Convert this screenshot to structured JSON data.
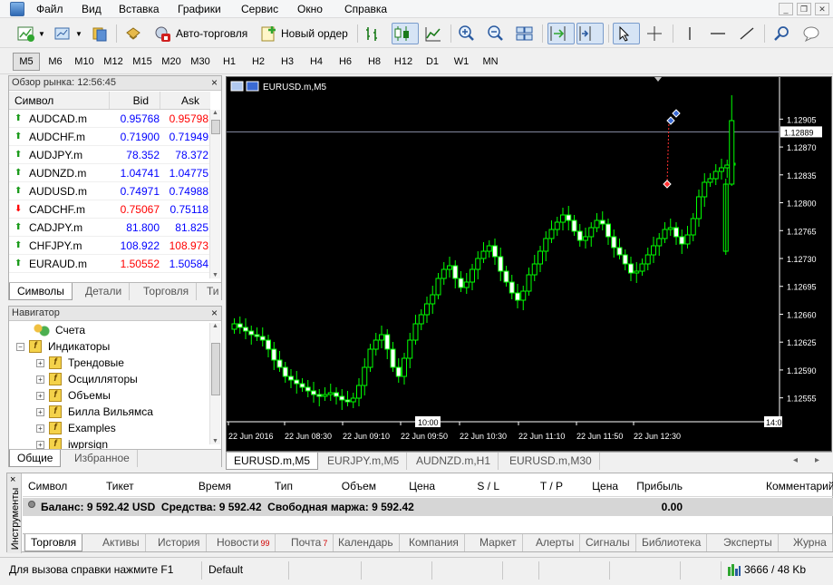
{
  "menu": [
    "Файл",
    "Вид",
    "Вставка",
    "Графики",
    "Сервис",
    "Окно",
    "Справка"
  ],
  "toolbar": {
    "autotrading_label": "Авто-торговля",
    "new_order_label": "Новый ордер"
  },
  "timeframes": [
    "M5",
    "M10",
    "M6",
    "M12",
    "M15",
    "M20",
    "M30",
    "H1",
    "H2",
    "H3",
    "H4",
    "H6",
    "H8",
    "H12",
    "D1",
    "W1",
    "MN"
  ],
  "timeframes_display": [
    "M5",
    "M6",
    "M10",
    "M12",
    "M15",
    "M20",
    "M30",
    "H1",
    "H2",
    "H3",
    "H4",
    "H6",
    "H8",
    "H12",
    "D1",
    "W1",
    "MN"
  ],
  "active_timeframe": "M5",
  "market_watch": {
    "title": "Обзор рынка: 12:56:45",
    "col_symbol": "Символ",
    "col_bid": "Bid",
    "col_ask": "Ask",
    "rows": [
      {
        "symbol": "AUDCAD.m",
        "bid": "0.95768",
        "ask": "0.95798",
        "dir": "up",
        "bid_color": "blue",
        "ask_color": "red"
      },
      {
        "symbol": "AUDCHF.m",
        "bid": "0.71900",
        "ask": "0.71949",
        "dir": "up",
        "bid_color": "blue",
        "ask_color": "blue"
      },
      {
        "symbol": "AUDJPY.m",
        "bid": "78.352",
        "ask": "78.372",
        "dir": "up",
        "bid_color": "blue",
        "ask_color": "blue"
      },
      {
        "symbol": "AUDNZD.m",
        "bid": "1.04741",
        "ask": "1.04775",
        "dir": "up",
        "bid_color": "blue",
        "ask_color": "blue"
      },
      {
        "symbol": "AUDUSD.m",
        "bid": "0.74971",
        "ask": "0.74988",
        "dir": "up",
        "bid_color": "blue",
        "ask_color": "blue"
      },
      {
        "symbol": "CADCHF.m",
        "bid": "0.75067",
        "ask": "0.75118",
        "dir": "down",
        "bid_color": "red",
        "ask_color": "blue"
      },
      {
        "symbol": "CADJPY.m",
        "bid": "81.800",
        "ask": "81.825",
        "dir": "up",
        "bid_color": "blue",
        "ask_color": "blue"
      },
      {
        "symbol": "CHFJPY.m",
        "bid": "108.922",
        "ask": "108.973",
        "dir": "up",
        "bid_color": "blue",
        "ask_color": "red"
      },
      {
        "symbol": "EURAUD.m",
        "bid": "1.50552",
        "ask": "1.50584",
        "dir": "up",
        "bid_color": "red",
        "ask_color": "blue"
      }
    ],
    "tabs": [
      "Символы",
      "Детали",
      "Торговля",
      "Ти"
    ]
  },
  "navigator": {
    "title": "Навигатор",
    "items": [
      {
        "label": "Счета",
        "level": 0
      },
      {
        "label": "Индикаторы",
        "level": 0
      },
      {
        "label": "Трендовые",
        "level": 1
      },
      {
        "label": "Осцилляторы",
        "level": 1
      },
      {
        "label": "Объемы",
        "level": 1
      },
      {
        "label": "Билла Вильямса",
        "level": 1
      },
      {
        "label": "Examples",
        "level": 1
      },
      {
        "label": "iwprsign",
        "level": 1
      }
    ],
    "tabs": [
      "Общие",
      "Избранное"
    ]
  },
  "chart": {
    "title": "EURUSD.m,M5",
    "price_labels": [
      "1.12905",
      "1.12870",
      "1.12835",
      "1.12800",
      "1.12765",
      "1.12730",
      "1.12695",
      "1.12660",
      "1.12625",
      "1.12590",
      "1.12555"
    ],
    "current_price": "1.12889",
    "time_labels": [
      "22 Jun 2016",
      "22 Jun 08:30",
      "22 Jun 09:10",
      "22 Jun 09:50",
      "22 Jun 10:30",
      "22 Jun 11:10",
      "22 Jun 11:50",
      "22 Jun 12:30"
    ],
    "marker_left": "10:00",
    "marker_right": "14:0",
    "tabs": [
      "EURUSD.m,M5",
      "EURJPY.m,M5",
      "AUDNZD.m,H1",
      "EURUSD.m,M30"
    ]
  },
  "terminal": {
    "side_label": "Инструменты",
    "columns": [
      "Символ",
      "Тикет",
      "Время",
      "Тип",
      "Объем",
      "Цена",
      "S / L",
      "T / P",
      "Цена",
      "Прибыль",
      "Комментарий"
    ],
    "balance_text": "Баланс: 9 592.42 USD  Средства: 9 592.42  Свободная маржа: 9 592.42",
    "profit": "0.00",
    "tabs": [
      {
        "label": "Торговля",
        "badge": ""
      },
      {
        "label": "Активы",
        "badge": ""
      },
      {
        "label": "История",
        "badge": ""
      },
      {
        "label": "Новости",
        "badge": "99"
      },
      {
        "label": "Почта",
        "badge": "7"
      },
      {
        "label": "Календарь",
        "badge": ""
      },
      {
        "label": "Компания",
        "badge": ""
      },
      {
        "label": "Маркет",
        "badge": ""
      },
      {
        "label": "Алерты",
        "badge": ""
      },
      {
        "label": "Сигналы",
        "badge": ""
      },
      {
        "label": "Библиотека",
        "badge": ""
      },
      {
        "label": "Эксперты",
        "badge": ""
      },
      {
        "label": "Журна",
        "badge": ""
      }
    ]
  },
  "status": {
    "help": "Для вызова справки нажмите F1",
    "profile": "Default",
    "traffic": "3666 / 48 Kb"
  },
  "colors": {
    "bull": "#00ff00",
    "bear": "#ffffff",
    "chart_bg": "#000000",
    "grid_text": "#ffffff",
    "bid_blue": "#0000ff",
    "ask_red": "#ff0000"
  }
}
